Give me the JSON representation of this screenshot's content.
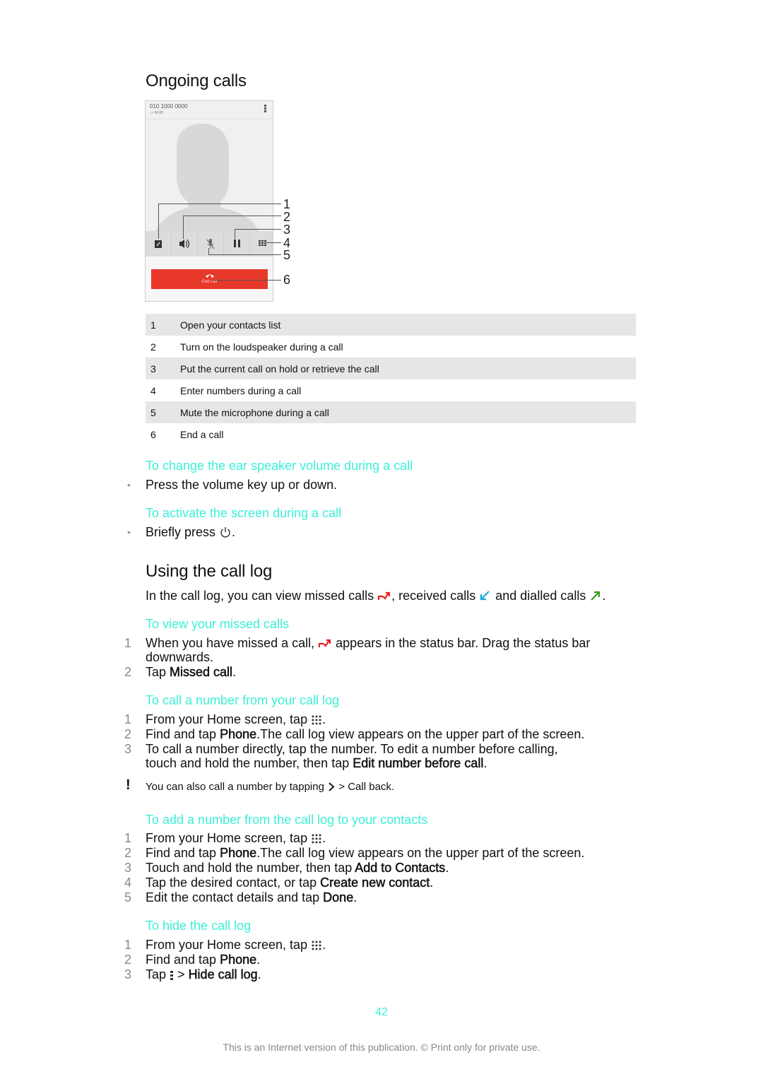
{
  "section1": {
    "title": "Ongoing calls",
    "phone": {
      "number": "010 1000 0000",
      "timer": "00:06",
      "end_call_label": "End call"
    },
    "callout_numbers": [
      "1",
      "2",
      "3",
      "4",
      "5",
      "6"
    ],
    "table": [
      {
        "num": "1",
        "text": "Open your contacts list"
      },
      {
        "num": "2",
        "text": "Turn on the loudspeaker during a call"
      },
      {
        "num": "3",
        "text": "Put the current call on hold or retrieve the call"
      },
      {
        "num": "4",
        "text": "Enter numbers during a call"
      },
      {
        "num": "5",
        "text": "Mute the microphone during a call"
      },
      {
        "num": "6",
        "text": "End a call"
      }
    ],
    "volume": {
      "heading": "To change the ear speaker volume during a call",
      "bullet": "Press the volume key up or down."
    },
    "activate": {
      "heading": "To activate the screen during a call",
      "bullet_before": "Briefly press",
      "bullet_after": "."
    }
  },
  "section2": {
    "title": "Using the call log",
    "intro": {
      "part1": "In the call log, you can view missed calls",
      "part2": ", received calls",
      "part3": "and dialled calls",
      "part4": "."
    },
    "icons": {
      "missed_color": "#e82020",
      "received_color": "#1aa8d8",
      "dialled_color": "#3a9a1a"
    },
    "missed": {
      "heading": "To view your missed calls",
      "steps": [
        {
          "num": "1",
          "a": "When you have missed a call,",
          "b": "appears in the status bar. Drag the status bar",
          "c": "downwards."
        },
        {
          "num": "2",
          "a": "Tap ",
          "bold": "Missed call",
          "c": "."
        }
      ]
    },
    "callnumber": {
      "heading": "To call a number from your call log",
      "step1": {
        "num": "1",
        "a": "From your Home screen, tap",
        "c": "."
      },
      "step2": {
        "num": "2",
        "a": "Find and tap ",
        "bold": "Phone",
        "c": ".The call log view appears on the upper part of the screen."
      },
      "step3": {
        "num": "3",
        "a": "To call a number directly, tap the number. To edit a number before calling,",
        "b": "touch and hold the number, then tap ",
        "bold": "Edit number before call",
        "c": "."
      },
      "note_before": "You can also call a number by tapping",
      "note_after": "> Call back."
    },
    "addnumber": {
      "heading": "To add a number from the call log to your contacts",
      "step1": {
        "num": "1",
        "a": "From your Home screen, tap",
        "c": "."
      },
      "step2": {
        "num": "2",
        "a": "Find and tap ",
        "bold": "Phone",
        "c": ".The call log view appears on the upper part of the screen."
      },
      "step3": {
        "num": "3",
        "a": "Touch and hold the number, then tap ",
        "bold": "Add to Contacts",
        "c": "."
      },
      "step4": {
        "num": "4",
        "a": "Tap the desired contact, or tap ",
        "bold": "Create new contact",
        "c": "."
      },
      "step5": {
        "num": "5",
        "a": "Edit the contact details and tap ",
        "bold": "Done",
        "c": "."
      }
    },
    "hidelog": {
      "heading": "To hide the call log",
      "step1": {
        "num": "1",
        "a": "From your Home screen, tap",
        "c": "."
      },
      "step2": {
        "num": "2",
        "a": "Find and tap ",
        "bold": "Phone",
        "c": "."
      },
      "step3": {
        "num": "3",
        "a": "Tap",
        "b": " > ",
        "bold": "Hide call log",
        "c": "."
      }
    }
  },
  "page_number": "42",
  "footer": "This is an Internet version of this publication. © Print only for private use."
}
